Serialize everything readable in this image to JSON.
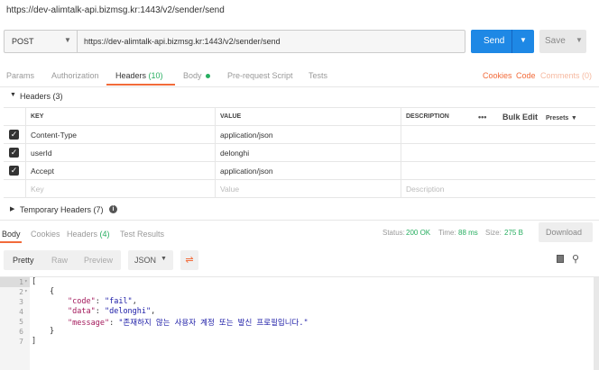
{
  "window": {
    "title": "https://dev-alimtalk-api.bizmsg.kr:1443/v2/sender/send"
  },
  "request": {
    "method": "POST",
    "url": "https://dev-alimtalk-api.bizmsg.kr:1443/v2/sender/send",
    "send_label": "Send",
    "save_label": "Save"
  },
  "request_tabs": [
    {
      "label": "Params"
    },
    {
      "label": "Authorization"
    },
    {
      "label": "Headers",
      "count": "(10)"
    },
    {
      "label": "Body"
    },
    {
      "label": "Pre-request Script"
    },
    {
      "label": "Tests"
    }
  ],
  "right_links": {
    "cookies": "Cookies",
    "code": "Code",
    "comments": "Comments (0)"
  },
  "headers_section": {
    "title": "Headers (3)",
    "columns": {
      "key": "KEY",
      "value": "VALUE",
      "description": "DESCRIPTION",
      "more": "•••",
      "bulk_edit": "Bulk Edit",
      "presets": "Presets"
    },
    "rows": [
      {
        "key": "Content-Type",
        "value": "application/json",
        "checked": true
      },
      {
        "key": "userId",
        "value": "delonghi",
        "checked": true
      },
      {
        "key": "Accept",
        "value": "application/json",
        "checked": true
      }
    ],
    "placeholder": {
      "key": "Key",
      "value": "Value",
      "description": "Description"
    }
  },
  "temporary_headers": {
    "label": "Temporary Headers (7)"
  },
  "response_tabs": [
    {
      "label": "Body"
    },
    {
      "label": "Cookies"
    },
    {
      "label": "Headers",
      "count": "(4)"
    },
    {
      "label": "Test Results"
    }
  ],
  "response_status": {
    "status_label": "Status:",
    "status_value": "200 OK",
    "time_label": "Time:",
    "time_value": "88 ms",
    "size_label": "Size:",
    "size_value": "275 B",
    "download_label": "Download"
  },
  "view_modes": {
    "pretty": "Pretty",
    "raw": "Raw",
    "preview": "Preview",
    "format": "JSON"
  },
  "response_body": {
    "line_numbers": [
      "1",
      "2",
      "3",
      "4",
      "5",
      "6",
      "7"
    ],
    "open_bracket": "[",
    "open_brace": "{",
    "code_key": "\"code\"",
    "code_value": "\"fail\"",
    "data_key": "\"data\"",
    "data_value": "\"delonghi\"",
    "message_key": "\"message\"",
    "message_value": "\"존재하지 않는 사용자 계정 또는 발신 프로필입니다.\"",
    "close_brace": "}",
    "close_bracket": "]"
  },
  "colors": {
    "accent": "#f26b3a",
    "send_button": "#1e88e5",
    "status_ok": "#27ae60"
  }
}
